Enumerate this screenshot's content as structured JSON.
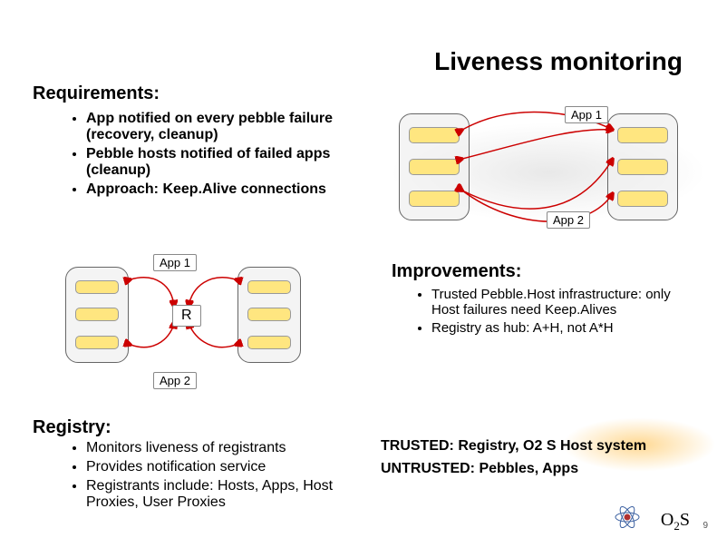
{
  "title": "Liveness monitoring",
  "requirements": {
    "heading": "Requirements:",
    "items": [
      "App notified on every pebble failure (recovery, cleanup)",
      "Pebble hosts notified of failed apps (cleanup)",
      "Approach: Keep.Alive connections"
    ]
  },
  "improvements": {
    "heading": "Improvements:",
    "items": [
      "Trusted Pebble.Host infrastructure: only Host failures need Keep.Alives",
      "Registry as hub: A+H, not A*H"
    ]
  },
  "registry": {
    "heading": "Registry:",
    "items": [
      "Monitors liveness of registrants",
      "Provides notification service",
      "Registrants include: Hosts, Apps, Host Proxies, User Proxies"
    ]
  },
  "trusted": "TRUSTED: Registry, O2 S Host system",
  "untrusted": "UNTRUSTED: Pebbles, Apps",
  "labels": {
    "app1": "App 1",
    "app2": "App 2",
    "reg": "R"
  },
  "footer": {
    "brand_pre": "O",
    "brand_sub": "2",
    "brand_post": "S",
    "page": "9"
  }
}
